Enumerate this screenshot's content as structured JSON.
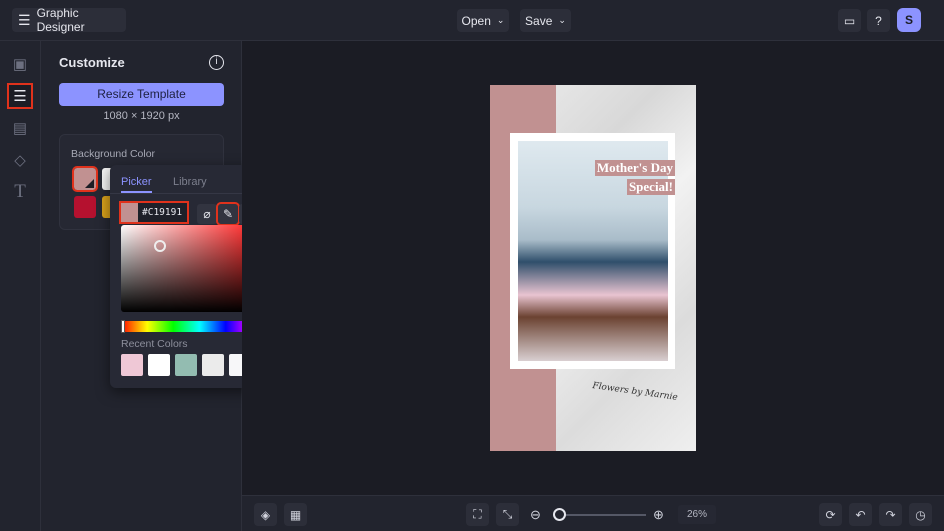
{
  "header": {
    "app_title": "Graphic Designer",
    "open_label": "Open",
    "save_label": "Save",
    "avatar_initial": "S"
  },
  "panel": {
    "title": "Customize",
    "resize_label": "Resize Template",
    "dimensions": "1080 × 1920 px",
    "bg_color_label": "Background Color"
  },
  "picker": {
    "tabs": [
      "Picker",
      "Library"
    ],
    "hex_value": "#C19191",
    "recent_label": "Recent Colors",
    "recent_colors": [
      "#efc8d6",
      "#ffffff",
      "#93bcb1",
      "#ebebeb",
      "#f7f7f9",
      "#e6bcbc"
    ]
  },
  "swatches": [
    "#c19191",
    "#f5f5f5",
    "#b5112f",
    "#d9a21b"
  ],
  "design": {
    "headline_1": "Mother's Day",
    "headline_2": "Special!",
    "signature": "Flowers by Marnie",
    "accent": "#c19191"
  },
  "bottom": {
    "zoom": "26%",
    "zoom_fraction": 0.05
  }
}
